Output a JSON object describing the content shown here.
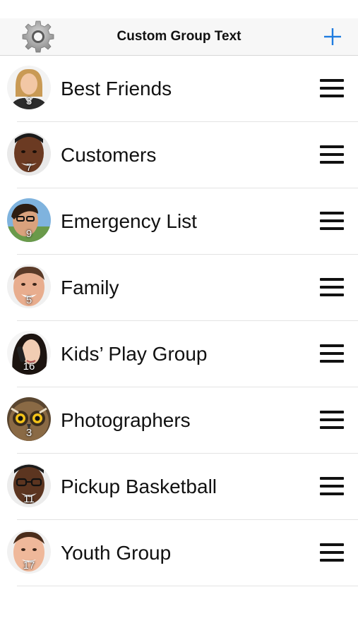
{
  "nav": {
    "title": "Custom Group Text",
    "settings_icon": "gear-icon",
    "add_icon": "plus-icon",
    "accent_color": "#1f7ce0"
  },
  "groups": [
    {
      "name": "Best Friends",
      "count": "3",
      "avatar": "woman-blonde-avatar"
    },
    {
      "name": "Customers",
      "count": "7",
      "avatar": "man-dark-avatar"
    },
    {
      "name": "Emergency List",
      "count": "9",
      "avatar": "man-glasses-outdoor-avatar"
    },
    {
      "name": "Family",
      "count": "5",
      "avatar": "man-smiling-avatar"
    },
    {
      "name": "Kids’ Play Group",
      "count": "16",
      "avatar": "woman-phone-avatar"
    },
    {
      "name": "Photographers",
      "count": "3",
      "avatar": "owl-avatar"
    },
    {
      "name": "Pickup Basketball",
      "count": "11",
      "avatar": "man-glasses-avatar"
    },
    {
      "name": "Youth Group",
      "count": "17",
      "avatar": "young-man-avatar"
    }
  ],
  "row_icon": "reorder-icon"
}
